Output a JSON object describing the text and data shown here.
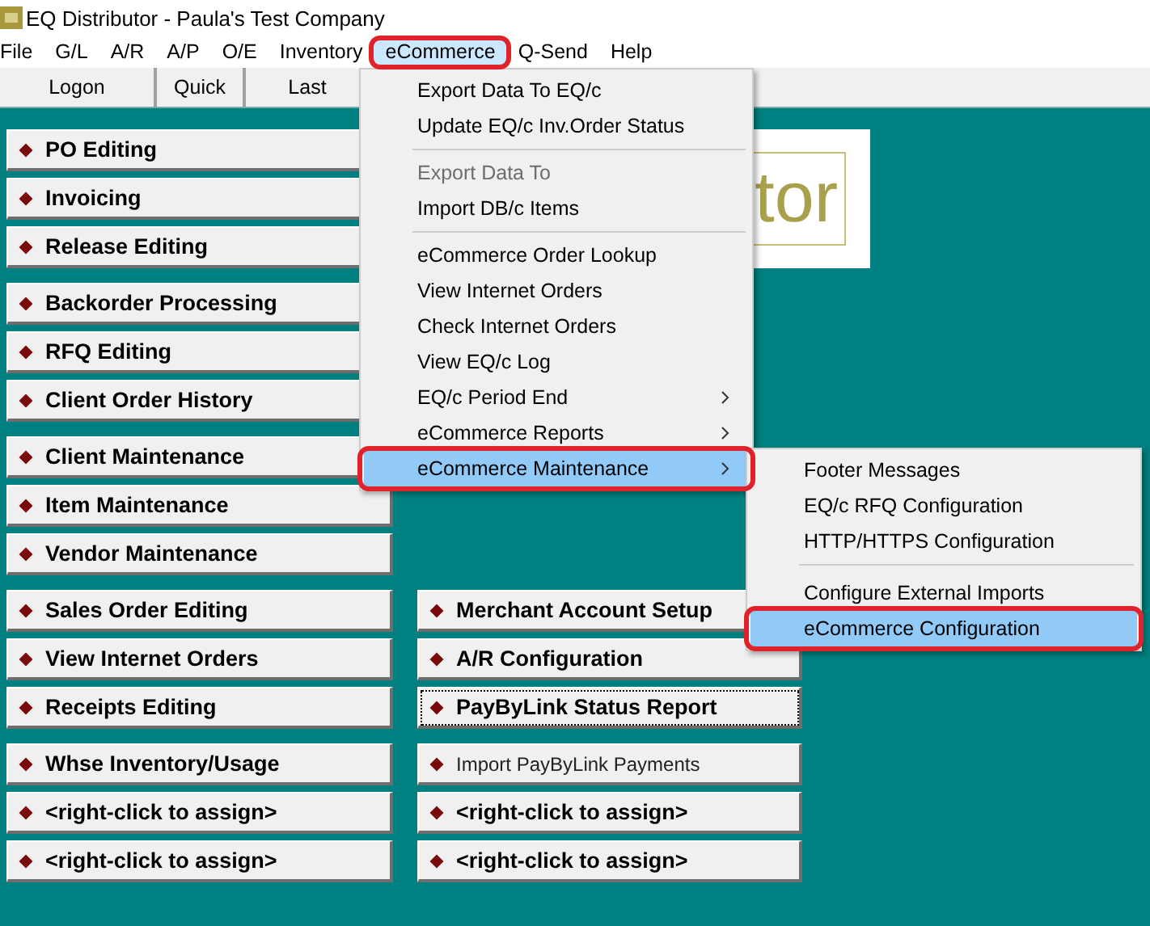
{
  "window": {
    "title": "EQ Distributor - Paula's Test Company"
  },
  "menu_bar": [
    {
      "label": "File",
      "selected": false,
      "outlined": false
    },
    {
      "label": "G/L",
      "selected": false,
      "outlined": false
    },
    {
      "label": "A/R",
      "selected": false,
      "outlined": false
    },
    {
      "label": "A/P",
      "selected": false,
      "outlined": false
    },
    {
      "label": "O/E",
      "selected": false,
      "outlined": false
    },
    {
      "label": "Inventory",
      "selected": false,
      "outlined": false
    },
    {
      "label": "eCommerce",
      "selected": true,
      "outlined": true
    },
    {
      "label": "Q-Send",
      "selected": false,
      "outlined": false
    },
    {
      "label": "Help",
      "selected": false,
      "outlined": false
    }
  ],
  "toolbar": [
    "Logon",
    "Quick",
    "Last"
  ],
  "button_rows": [
    {
      "left": [
        {
          "label": "PO Editing",
          "kind": "bold",
          "focused": false
        },
        {
          "label": "Invoicing",
          "kind": "bold",
          "focused": false
        },
        {
          "label": "Release Editing",
          "kind": "bold",
          "focused": false
        }
      ],
      "right": []
    },
    {
      "left": [
        {
          "label": "Backorder Processing",
          "kind": "bold",
          "focused": false
        },
        {
          "label": "RFQ Editing",
          "kind": "bold",
          "focused": false
        },
        {
          "label": "Client Order History",
          "kind": "bold",
          "focused": false
        }
      ],
      "right": []
    },
    {
      "left": [
        {
          "label": "Client Maintenance",
          "kind": "bold",
          "focused": false
        },
        {
          "label": "Item Maintenance",
          "kind": "bold",
          "focused": false
        },
        {
          "label": "Vendor Maintenance",
          "kind": "bold",
          "focused": false
        }
      ],
      "right": []
    },
    {
      "left": [
        {
          "label": "Sales Order Editing",
          "kind": "bold",
          "focused": false
        },
        {
          "label": "View Internet Orders",
          "kind": "bold",
          "focused": false
        },
        {
          "label": "Receipts Editing",
          "kind": "bold",
          "focused": false
        }
      ],
      "right": [
        {
          "label": "Merchant Account Setup",
          "kind": "bold",
          "focused": false
        },
        {
          "label": "A/R Configuration",
          "kind": "bold",
          "focused": false
        },
        {
          "label": "PayByLink Status Report",
          "kind": "bold",
          "focused": true
        }
      ]
    },
    {
      "left": [
        {
          "label": "Whse Inventory/Usage",
          "kind": "bold",
          "focused": false
        },
        {
          "label": "<right-click to assign>",
          "kind": "bold",
          "focused": false
        },
        {
          "label": "<right-click to assign>",
          "kind": "bold",
          "focused": false
        }
      ],
      "right": [
        {
          "label": "Import PayByLink Payments",
          "kind": "plain",
          "focused": false
        },
        {
          "label": "<right-click to assign>",
          "kind": "bold",
          "focused": false
        },
        {
          "label": "<right-click to assign>",
          "kind": "bold",
          "focused": false
        }
      ]
    }
  ],
  "logo": {
    "text": "tor"
  },
  "menu": {
    "groups": [
      [
        {
          "label": "Export Data To EQ/c",
          "disabled": false,
          "submenu": false,
          "selected": false,
          "outlined": false
        },
        {
          "label": "Update EQ/c Inv.Order Status",
          "disabled": false,
          "submenu": false,
          "selected": false,
          "outlined": false
        }
      ],
      [
        {
          "label": "Export Data To",
          "disabled": true,
          "submenu": false,
          "selected": false,
          "outlined": false
        },
        {
          "label": "Import DB/c Items",
          "disabled": false,
          "submenu": false,
          "selected": false,
          "outlined": false
        }
      ],
      [
        {
          "label": "eCommerce Order Lookup",
          "disabled": false,
          "submenu": false,
          "selected": false,
          "outlined": false
        },
        {
          "label": "View Internet Orders",
          "disabled": false,
          "submenu": false,
          "selected": false,
          "outlined": false
        },
        {
          "label": "Check Internet Orders",
          "disabled": false,
          "submenu": false,
          "selected": false,
          "outlined": false
        },
        {
          "label": "View EQ/c Log",
          "disabled": false,
          "submenu": false,
          "selected": false,
          "outlined": false
        },
        {
          "label": "EQ/c Period End",
          "disabled": false,
          "submenu": true,
          "selected": false,
          "outlined": false
        },
        {
          "label": "eCommerce Reports",
          "disabled": false,
          "submenu": true,
          "selected": false,
          "outlined": false
        },
        {
          "label": "eCommerce Maintenance",
          "disabled": false,
          "submenu": true,
          "selected": true,
          "outlined": true
        }
      ]
    ]
  },
  "submenu": {
    "groups": [
      [
        {
          "label": "Footer Messages",
          "disabled": false,
          "submenu": false,
          "selected": false,
          "outlined": false
        },
        {
          "label": "EQ/c RFQ Configuration",
          "disabled": false,
          "submenu": false,
          "selected": false,
          "outlined": false
        },
        {
          "label": "HTTP/HTTPS Configuration",
          "disabled": false,
          "submenu": false,
          "selected": false,
          "outlined": false
        }
      ],
      [
        {
          "label": "Configure External Imports",
          "disabled": false,
          "submenu": false,
          "selected": false,
          "outlined": false
        },
        {
          "label": "eCommerce Configuration",
          "disabled": false,
          "submenu": false,
          "selected": true,
          "outlined": true
        }
      ]
    ]
  }
}
